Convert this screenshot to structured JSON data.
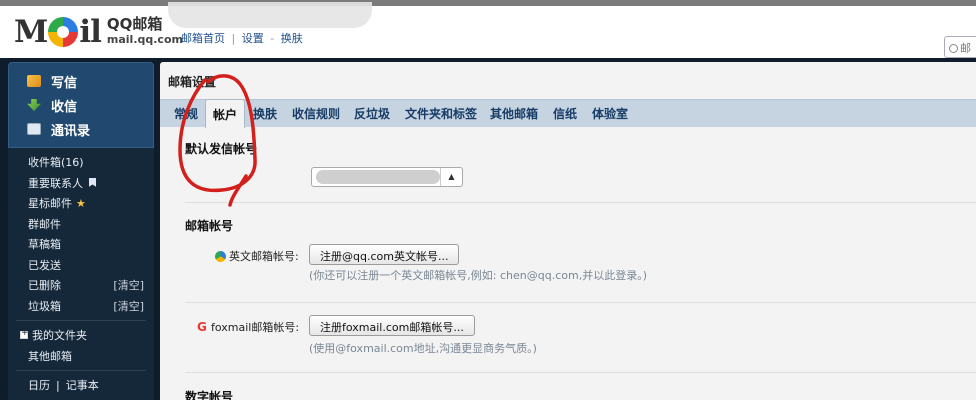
{
  "app": {
    "logo_text": "M  il",
    "brand_name": "QQ邮箱",
    "brand_domain": "mail.qq.com"
  },
  "topnav": {
    "home": "邮箱首页",
    "sep": "|",
    "settings": "设置",
    "dash": "-",
    "skin": "换肤"
  },
  "search": {
    "placeholder": "邮"
  },
  "sidebar": {
    "top_items": [
      {
        "label": "写信",
        "icon": "compose-icon"
      },
      {
        "label": "收信",
        "icon": "inbox-download-icon"
      },
      {
        "label": "通讯录",
        "icon": "contacts-icon"
      }
    ],
    "mail_items": [
      {
        "label": "收件箱(16)",
        "extra": ""
      },
      {
        "label": "重要联系人",
        "extra": ""
      },
      {
        "label": "星标邮件",
        "extra": ""
      },
      {
        "label": "群邮件",
        "extra": ""
      },
      {
        "label": "草稿箱",
        "extra": ""
      },
      {
        "label": "已发送",
        "extra": ""
      },
      {
        "label": "已删除",
        "extra": "[清空]"
      },
      {
        "label": "垃圾箱",
        "extra": "[清空]"
      }
    ],
    "folders_title": "我的文件夹",
    "other_mailbox": "其他邮箱",
    "calendar": "日历",
    "calendar_sep": "|",
    "notes": "记事本"
  },
  "main": {
    "title": "邮箱设置",
    "tabs": [
      "常规",
      "帐户",
      "换肤",
      "收信规则",
      "反垃圾",
      "文件夹和标签",
      "其他邮箱",
      "信纸",
      "体验室"
    ],
    "active_tab": "帐户",
    "default_sender_title": "默认发信帐号",
    "mailbox_accounts_title": "邮箱帐号",
    "english_label": "英文邮箱帐号:",
    "english_button": "注册@qq.com英文帐号...",
    "english_hint": "(你还可以注册一个英文邮箱帐号,例如: chen@qq.com,并以此登录。)",
    "foxmail_label": "foxmail邮箱帐号:",
    "foxmail_button": "注册foxmail.com邮箱帐号...",
    "foxmail_hint": "(使用@foxmail.com地址,沟通更显商务气质。)",
    "digital_title": "数字帐号"
  },
  "colors": {
    "frame": "#0e1c2b",
    "sidebar_top": "#21496f",
    "tabbar": "#c6d3e0",
    "link": "#1d4f8f",
    "annotation": "#d3201c"
  }
}
